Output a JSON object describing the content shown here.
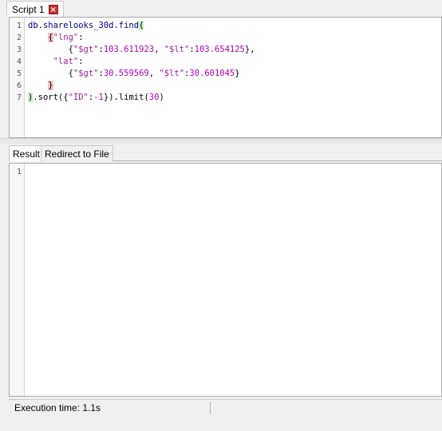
{
  "script_tab": {
    "label": "Script 1",
    "close_glyph": "×"
  },
  "editor": {
    "line_numbers": [
      "1",
      "2",
      "3",
      "4",
      "5",
      "6",
      "7"
    ],
    "lines": [
      [
        {
          "t": "db.sharelooks_30d.find",
          "c": "kw"
        },
        {
          "t": "(",
          "c": "br-ok"
        }
      ],
      [
        {
          "t": "    ",
          "c": ""
        },
        {
          "t": "{",
          "c": "br-hl"
        },
        {
          "t": "\"lng\"",
          "c": "str"
        },
        {
          "t": ":",
          "c": ""
        }
      ],
      [
        {
          "t": "        {",
          "c": ""
        },
        {
          "t": "\"$gt\"",
          "c": "str"
        },
        {
          "t": ":",
          "c": ""
        },
        {
          "t": "103.611923",
          "c": "num"
        },
        {
          "t": ", ",
          "c": ""
        },
        {
          "t": "\"$lt\"",
          "c": "str"
        },
        {
          "t": ":",
          "c": ""
        },
        {
          "t": "103.654125",
          "c": "num"
        },
        {
          "t": "},",
          "c": ""
        }
      ],
      [
        {
          "t": "     ",
          "c": ""
        },
        {
          "t": "\"lat\"",
          "c": "str"
        },
        {
          "t": ":",
          "c": ""
        }
      ],
      [
        {
          "t": "        {",
          "c": ""
        },
        {
          "t": "\"$gt\"",
          "c": "str"
        },
        {
          "t": ":",
          "c": ""
        },
        {
          "t": "30.559569",
          "c": "num"
        },
        {
          "t": ", ",
          "c": ""
        },
        {
          "t": "\"$lt\"",
          "c": "str"
        },
        {
          "t": ":",
          "c": ""
        },
        {
          "t": "30.601045",
          "c": "num"
        },
        {
          "t": "}",
          "c": ""
        }
      ],
      [
        {
          "t": "    ",
          "c": ""
        },
        {
          "t": "}",
          "c": "br-hl"
        }
      ],
      [
        {
          "t": ")",
          "c": "br-ok"
        },
        {
          "t": ".sort({",
          "c": ""
        },
        {
          "t": "\"ID\"",
          "c": "str"
        },
        {
          "t": ":",
          "c": ""
        },
        {
          "t": "-1",
          "c": "num"
        },
        {
          "t": "}).limit(",
          "c": ""
        },
        {
          "t": "30",
          "c": "num"
        },
        {
          "t": ")",
          "c": ""
        }
      ]
    ]
  },
  "result_tabs": {
    "active": "Result",
    "inactive": "Redirect to File"
  },
  "result": {
    "line_numbers": [
      "1"
    ]
  },
  "status": {
    "text": "Execution time: 1.1s"
  }
}
